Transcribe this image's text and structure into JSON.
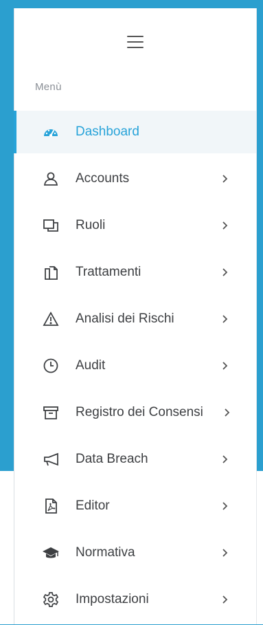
{
  "menu": {
    "heading": "Menù",
    "toggle_icon": "hamburger-icon",
    "items": [
      {
        "label": "Dashboard",
        "icon": "dashboard-icon",
        "active": true,
        "has_submenu": false
      },
      {
        "label": "Accounts",
        "icon": "user-icon",
        "active": false,
        "has_submenu": true
      },
      {
        "label": "Ruoli",
        "icon": "roles-icon",
        "active": false,
        "has_submenu": true
      },
      {
        "label": "Trattamenti",
        "icon": "documents-icon",
        "active": false,
        "has_submenu": true
      },
      {
        "label": "Analisi dei Rischi",
        "icon": "warning-icon",
        "active": false,
        "has_submenu": true
      },
      {
        "label": "Audit",
        "icon": "clock-icon",
        "active": false,
        "has_submenu": true
      },
      {
        "label": "Registro dei Consensi",
        "icon": "archive-icon",
        "active": false,
        "has_submenu": true
      },
      {
        "label": "Data Breach",
        "icon": "megaphone-icon",
        "active": false,
        "has_submenu": true
      },
      {
        "label": "Editor",
        "icon": "pdf-file-icon",
        "active": false,
        "has_submenu": true
      },
      {
        "label": "Normativa",
        "icon": "graduation-cap-icon",
        "active": false,
        "has_submenu": true
      },
      {
        "label": "Impostazioni",
        "icon": "gear-icon",
        "active": false,
        "has_submenu": true
      }
    ]
  },
  "colors": {
    "accent": "#27a3d9",
    "frame": "#2b9fcf",
    "text": "#3d3f42",
    "muted": "#8a8f96",
    "active_bg": "#f1f6f9"
  }
}
